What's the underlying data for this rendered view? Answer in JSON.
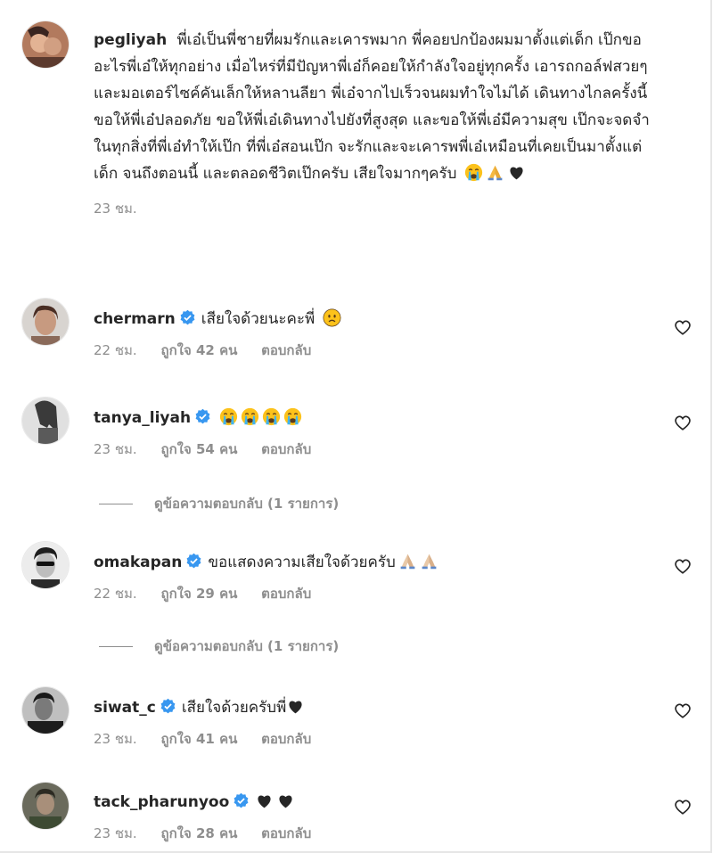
{
  "comments": [
    {
      "username": "pegliyah",
      "verified": false,
      "text": "พี่เอ๋เป็นพี่ชายที่ผมรักและเคารพมาก พี่คอยปกป้องผมมาตั้งแต่เด็ก เป๊กขออะไรพี่เอ๋ให้ทุกอย่าง เมื่อไหร่ที่มีปัญหาพี่เอ๋ก็คอยให้กำลังใจอยู่ทุกครั้ง เอารถกอล์ฟสวยๆ และมอเตอร์ไซค์คันเล็กให้หลานลียา พี่เอ๋จากไปเร็วจนผมทำใจไม่ได้ เดินทางไกลครั้งนี้ ขอให้พี่เอ๋ปลอดภัย ขอให้พี่เอ๋เดินทางไปยังที่สูงสุด และขอให้พี่เอ๋มีความสุข เป๊กจะจดจำในทุกสิ่งที่พี่เอ๋ทำให้เป๊ก ที่พี่เอ๋สอนเป๊ก จะรักและจะเคารพพี่เอ๋เหมือนที่เคยเป็นมาตั้งแต่เด็ก จนถึงตอนนี้ และตลอดชีวิตเป๊กครับ เสียใจมากๆครับ",
      "emojis": [
        "crying-face",
        "folded-hands",
        "black-heart"
      ],
      "time": "23 ชม.",
      "likes": "",
      "reply": ""
    },
    {
      "username": "chermarn",
      "verified": true,
      "text": "เสียใจด้วยนะคะพี่",
      "emojis": [
        "slightly-frowning-face"
      ],
      "time": "22 ชม.",
      "likes": "ถูกใจ 42 คน",
      "reply": "ตอบกลับ"
    },
    {
      "username": "tanya_liyah",
      "verified": true,
      "text": "",
      "emojis": [
        "crying-face",
        "crying-face",
        "crying-face",
        "crying-face"
      ],
      "time": "23 ชม.",
      "likes": "ถูกใจ 54 คน",
      "reply": "ตอบกลับ",
      "view_replies": "ดูข้อความตอบกลับ (1 รายการ)"
    },
    {
      "username": "omakapan",
      "verified": true,
      "text": "ขอแสดงความเสียใจด้วยครับ",
      "emojis": [
        "folded-hands",
        "folded-hands"
      ],
      "time": "22 ชม.",
      "likes": "ถูกใจ 29 คน",
      "reply": "ตอบกลับ",
      "view_replies": "ดูข้อความตอบกลับ (1 รายการ)"
    },
    {
      "username": "siwat_c",
      "verified": true,
      "text": "เสียใจด้วยครับพี่",
      "emojis": [
        "black-heart"
      ],
      "time": "23 ชม.",
      "likes": "ถูกใจ 41 คน",
      "reply": "ตอบกลับ"
    },
    {
      "username": "tack_pharunyoo",
      "verified": true,
      "text": "",
      "emojis": [
        "black-heart",
        "black-heart"
      ],
      "time": "23 ชม.",
      "likes": "ถูกใจ 28 คน",
      "reply": "ตอบกลับ"
    }
  ],
  "colors": {
    "verified_blue": "#3897f0",
    "meta_gray": "#8e8e8e",
    "text": "#262626"
  }
}
